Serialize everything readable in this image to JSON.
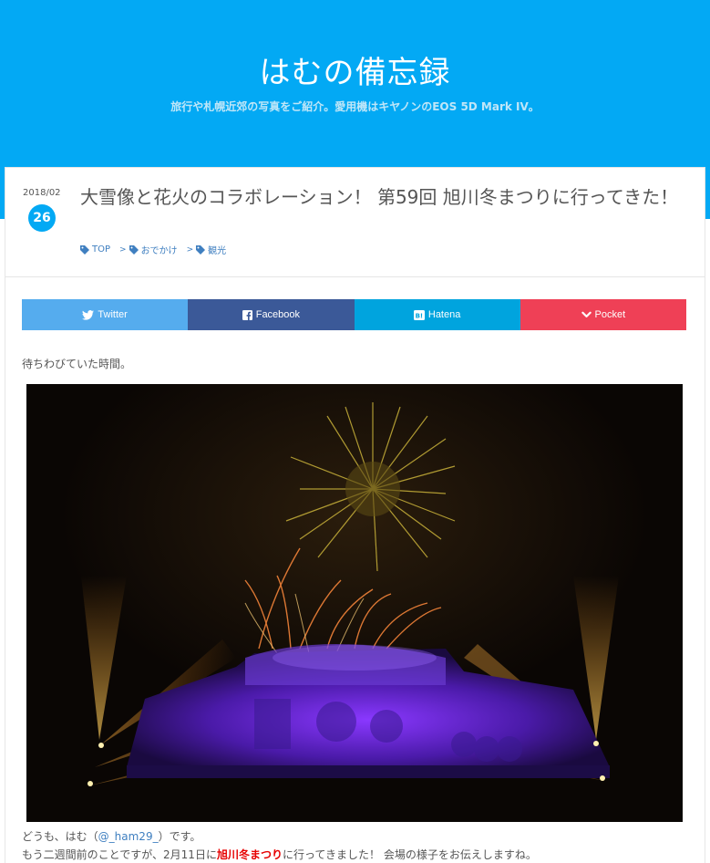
{
  "header": {
    "title": "はむの備忘録",
    "description": "旅行や札幌近郊の写真をご紹介。愛用機はキヤノンのEOS 5D Mark IV。"
  },
  "post": {
    "date": "2018/02",
    "day": "26",
    "title": "大雪像と花火のコラボレーション！ 第59回 旭川冬まつりに行ってきた！",
    "categories": [
      {
        "label": "TOP"
      },
      {
        "label": "おでかけ"
      },
      {
        "label": "観光"
      }
    ],
    "separator": ">"
  },
  "share": {
    "twitter": "Twitter",
    "facebook": "Facebook",
    "hatena": "Hatena",
    "pocket": "Pocket"
  },
  "content": {
    "intro": "待ちわびていた時間。",
    "line1_prefix": "どうも、はむ（",
    "line1_link": "@_ham29_",
    "line1_suffix": "）です。",
    "line2_prefix": "もう二週間前のことですが、2月11日に",
    "line2_highlight": "旭川冬まつり",
    "line2_suffix": "に行ってきました！ 会場の様子をお伝えしますね。"
  },
  "colors": {
    "header": "#03a9f4",
    "twitter": "#55acee",
    "facebook": "#3b5998",
    "hatena": "#00a4de",
    "pocket": "#ef4056",
    "link": "#3f7fc0",
    "highlight": "#e60000"
  }
}
